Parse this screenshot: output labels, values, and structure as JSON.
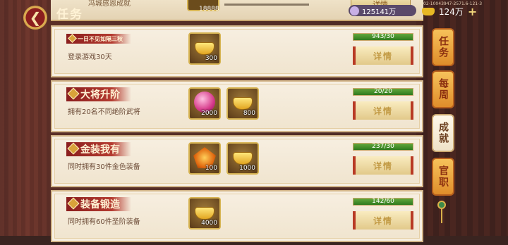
{
  "header": {
    "back_icon": "arrow-left-icon",
    "title": "任务",
    "partial_desc": "冯城感恩成就",
    "partial_reward_qty": "18888",
    "partial_claim_label": "详情",
    "stamina_value": "125141万",
    "uid_text": "02-10043947-2571.6-121-3",
    "gold_value": "124万",
    "gold_plus": "+"
  },
  "tasks": [
    {
      "tag": "一日不见如隔三秋",
      "desc": "登录游戏30天",
      "rewards": [
        {
          "icon": "gold-ingot-icon",
          "qty": "300"
        }
      ],
      "progress_label": "943/30",
      "progress": 1.0,
      "claim_label": "详情"
    },
    {
      "tag": "大将升阶",
      "desc": "拥有20名不同绝阶武将",
      "rewards": [
        {
          "icon": "pink-orb-icon",
          "qty": "2000"
        },
        {
          "icon": "gold-ingot-icon",
          "qty": "800"
        }
      ],
      "progress_label": "20/20",
      "progress": 1.0,
      "claim_label": "详情"
    },
    {
      "tag": "金装我有",
      "desc": "同时拥有30件金色装备",
      "rewards": [
        {
          "icon": "gold-armor-icon",
          "qty": "100"
        },
        {
          "icon": "gold-ingot-icon",
          "qty": "1000"
        }
      ],
      "progress_label": "237/30",
      "progress": 1.0,
      "claim_label": "详情"
    },
    {
      "tag": "装备锻造",
      "desc": "同时拥有60件圣阶装备",
      "rewards": [
        {
          "icon": "gold-ingot-icon",
          "qty": "4000"
        }
      ],
      "progress_label": "142/60",
      "progress": 1.0,
      "claim_label": "详情"
    }
  ],
  "side_tabs": [
    "任务",
    "每周",
    "成就",
    "官职"
  ],
  "active_tab": 2
}
